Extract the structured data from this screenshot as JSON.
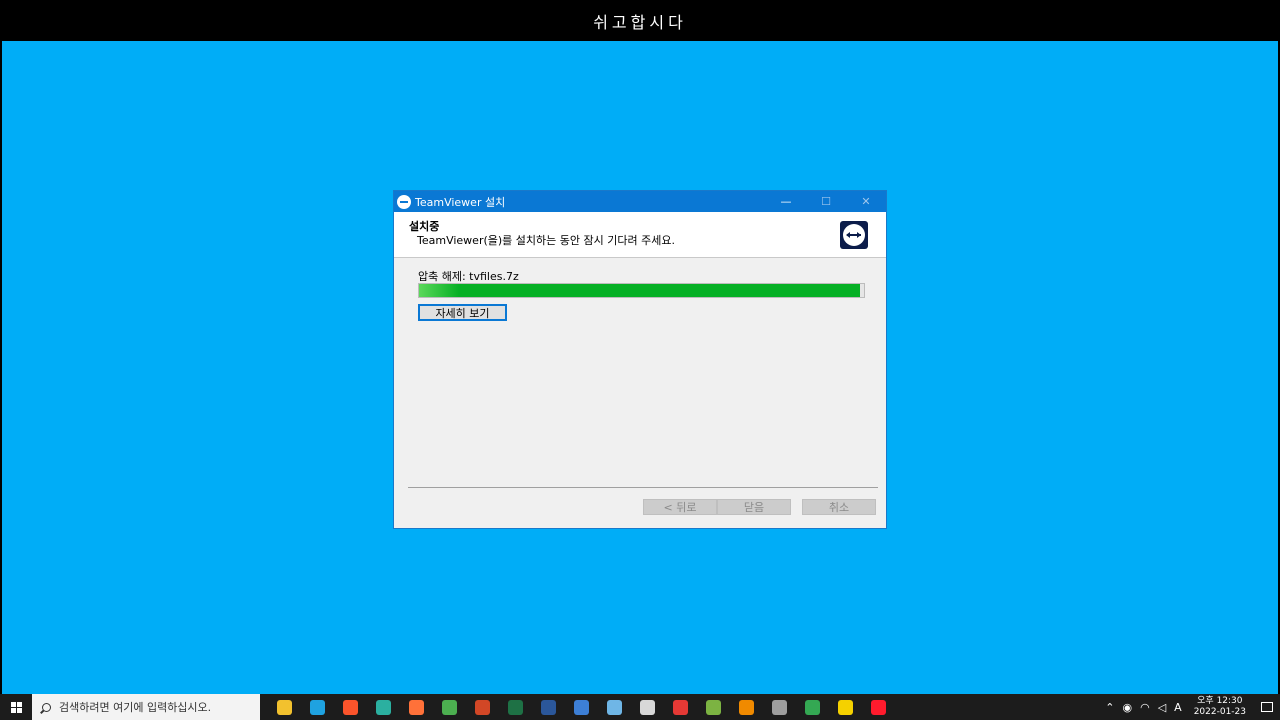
{
  "banner": {
    "text": "쉬고합시다"
  },
  "installer": {
    "window_title": "TeamViewer 설치",
    "header_title": "설치중",
    "header_subtitle": "TeamViewer(을)를 설치하는 동안 잠시 기다려 주세요.",
    "status_text": "압축 해제: tvfiles.7z",
    "progress_percent": 99,
    "details_button": "자세히 보기",
    "back_button": "< 뒤로",
    "close_button": "닫음",
    "cancel_button": "취소",
    "minimize": "—",
    "maximize": "☐",
    "close_x": "✕"
  },
  "taskbar": {
    "search_placeholder": "검색하려면 여기에 입력하십시오.",
    "apps": [
      {
        "name": "file-explorer-icon",
        "color": "#f2c12e"
      },
      {
        "name": "edge-icon",
        "color": "#1fa2e0"
      },
      {
        "name": "brave-icon",
        "color": "#fb542b"
      },
      {
        "name": "app-icon",
        "color": "#2bb0a0"
      },
      {
        "name": "firefox-icon",
        "color": "#ff7139"
      },
      {
        "name": "chrome-icon",
        "color": "#4caf50"
      },
      {
        "name": "powerpoint-icon",
        "color": "#d24726"
      },
      {
        "name": "excel-icon",
        "color": "#1e7145"
      },
      {
        "name": "word-icon",
        "color": "#2b579a"
      },
      {
        "name": "app-icon",
        "color": "#3d7fd6"
      },
      {
        "name": "app-icon",
        "color": "#6fb6e6"
      },
      {
        "name": "app-icon",
        "color": "#d8d8d8"
      },
      {
        "name": "app-icon",
        "color": "#e53935"
      },
      {
        "name": "app-icon",
        "color": "#7cb342"
      },
      {
        "name": "vlc-icon",
        "color": "#f08a00"
      },
      {
        "name": "calculator-icon",
        "color": "#9e9e9e"
      },
      {
        "name": "chrome-icon",
        "color": "#34a853"
      },
      {
        "name": "app-icon",
        "color": "#f5d100"
      },
      {
        "name": "opera-icon",
        "color": "#ff1b2d"
      }
    ],
    "ime": "A",
    "clock_time": "오후 12:30",
    "clock_date": "2022-01-23"
  }
}
